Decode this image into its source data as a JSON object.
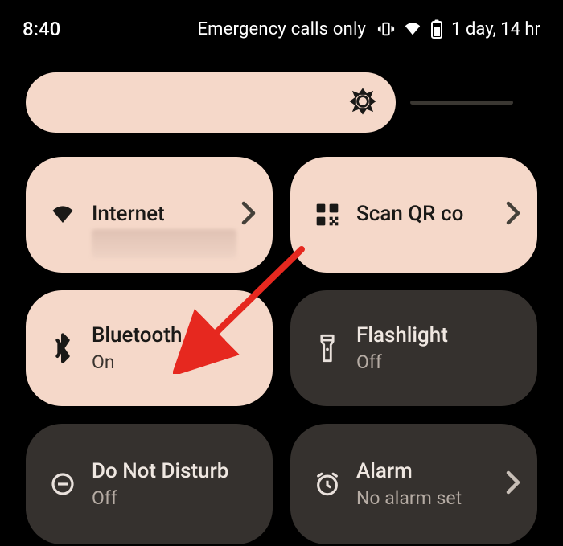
{
  "status": {
    "time": "8:40",
    "emergency": "Emergency calls only",
    "battery_text": "1 day, 14 hr"
  },
  "tiles": {
    "internet": {
      "title": "Internet",
      "subtitle": ""
    },
    "qr": {
      "title": "Scan QR co",
      "subtitle": ""
    },
    "bluetooth": {
      "title": "Bluetooth",
      "subtitle": "On"
    },
    "flashlight": {
      "title": "Flashlight",
      "subtitle": "Off"
    },
    "dnd": {
      "title": "Do Not Disturb",
      "subtitle": "Off"
    },
    "alarm": {
      "title": "Alarm",
      "subtitle": "No alarm set"
    }
  },
  "colors": {
    "tile_active_bg": "#f5d8c9",
    "tile_inactive_bg": "#35312e",
    "annotation_arrow": "#e6281f"
  }
}
